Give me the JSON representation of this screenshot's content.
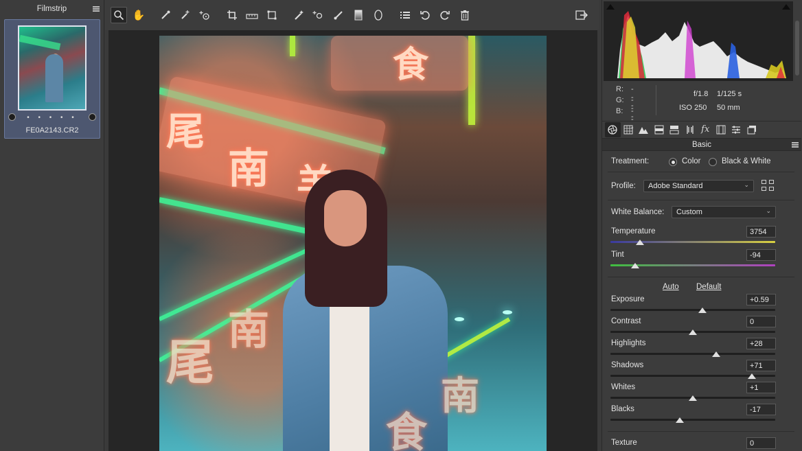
{
  "filmstrip": {
    "title": "Filmstrip",
    "rating": "• • • • •",
    "filename": "FE0A2143.CR2"
  },
  "toolbar": {
    "tools": [
      {
        "name": "zoom-tool",
        "icon": "magnifier"
      },
      {
        "name": "hand-tool",
        "icon": "hand"
      },
      {
        "name": "white-balance-tool",
        "icon": "eyedropper"
      },
      {
        "name": "color-sampler-tool",
        "icon": "eyedropper-plus"
      },
      {
        "name": "targeted-adjustment-tool",
        "icon": "target"
      },
      {
        "name": "crop-tool",
        "icon": "crop"
      },
      {
        "name": "straighten-tool",
        "icon": "level"
      },
      {
        "name": "transform-tool",
        "icon": "transform"
      },
      {
        "name": "spot-removal-tool",
        "icon": "brush-spot"
      },
      {
        "name": "red-eye-tool",
        "icon": "eye-plus"
      },
      {
        "name": "adjustment-brush-tool",
        "icon": "brush"
      },
      {
        "name": "graduated-filter-tool",
        "icon": "gradient"
      },
      {
        "name": "radial-filter-tool",
        "icon": "ellipse"
      },
      {
        "name": "preferences-tool",
        "icon": "list"
      },
      {
        "name": "rotate-left-tool",
        "icon": "rotate-ccw"
      },
      {
        "name": "rotate-right-tool",
        "icon": "rotate-cw"
      },
      {
        "name": "delete-tool",
        "icon": "trash"
      }
    ]
  },
  "histogram": {
    "r_label": "R:",
    "r_value": "---",
    "g_label": "G:",
    "g_value": "---",
    "b_label": "B:",
    "b_value": "---",
    "aperture": "f/1.8",
    "shutter": "1/125 s",
    "iso": "ISO 250",
    "focal_length": "50 mm"
  },
  "panel": {
    "title": "Basic",
    "treatment_label": "Treatment:",
    "treatment_color": "Color",
    "treatment_bw": "Black & White",
    "treatment_selected": "Color",
    "profile_label": "Profile:",
    "profile_value": "Adobe Standard",
    "wb_label": "White Balance:",
    "wb_value": "Custom",
    "auto_label": "Auto",
    "default_label": "Default",
    "sliders": {
      "temperature": {
        "label": "Temperature",
        "value": "3754",
        "position": 0.18
      },
      "tint": {
        "label": "Tint",
        "value": "-94",
        "position": 0.15
      },
      "exposure": {
        "label": "Exposure",
        "value": "+0.59",
        "position": 0.56
      },
      "contrast": {
        "label": "Contrast",
        "value": "0",
        "position": 0.5
      },
      "highlights": {
        "label": "Highlights",
        "value": "+28",
        "position": 0.64
      },
      "shadows": {
        "label": "Shadows",
        "value": "+71",
        "position": 0.86
      },
      "whites": {
        "label": "Whites",
        "value": "+1",
        "position": 0.5
      },
      "blacks": {
        "label": "Blacks",
        "value": "-17",
        "position": 0.42
      },
      "texture": {
        "label": "Texture",
        "value": "0",
        "position": 0.5
      }
    }
  },
  "colors": {
    "temperature_track_start": "#3a3aa0",
    "temperature_track_end": "#d8d040",
    "tint_track_start": "#3fbf3f",
    "tint_track_end": "#b040c0"
  }
}
